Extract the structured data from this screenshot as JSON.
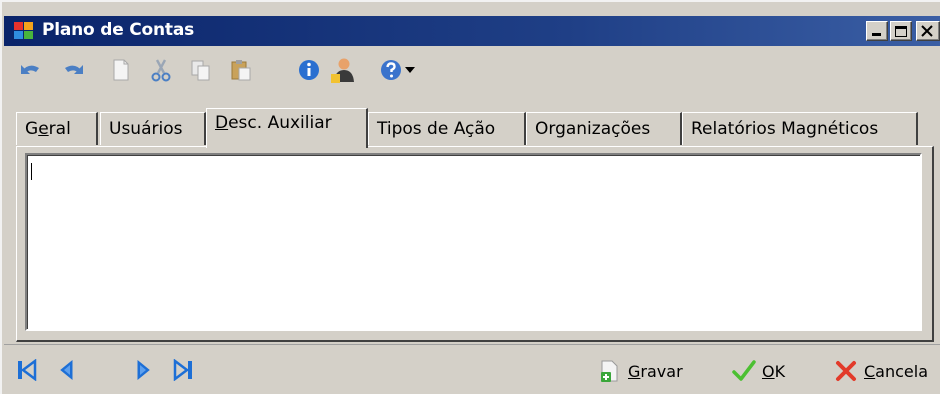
{
  "window": {
    "title": "Plano de Contas",
    "controls": [
      "minimize",
      "maximize",
      "close"
    ]
  },
  "toolbar": {
    "buttons": [
      {
        "name": "undo-icon"
      },
      {
        "name": "redo-icon"
      },
      {
        "name": "new-document-icon"
      },
      {
        "name": "cut-icon"
      },
      {
        "name": "copy-icon"
      },
      {
        "name": "paste-icon"
      },
      {
        "name": "info-icon"
      },
      {
        "name": "user-icon"
      },
      {
        "name": "help-icon"
      },
      {
        "name": "dropdown-arrow-icon"
      }
    ]
  },
  "tabs": [
    {
      "label_pre": "G",
      "label_ul": "e",
      "label_post": "ral",
      "active": false
    },
    {
      "label": "Usuários",
      "active": false
    },
    {
      "label_ul": "D",
      "label_post": "esc. Auxiliar",
      "active": true
    },
    {
      "label": "Tipos de Ação",
      "active": false
    },
    {
      "label": "Organizações",
      "active": false
    },
    {
      "label": "Relatórios Magnéticos",
      "active": false
    }
  ],
  "memo": {
    "value": ""
  },
  "navigation": [
    "first-record-icon",
    "previous-record-icon",
    "next-record-icon",
    "last-record-icon"
  ],
  "actions": {
    "save": {
      "ul": "G",
      "rest": "ravar"
    },
    "ok": {
      "ul": "O",
      "rest": "K"
    },
    "cancel": {
      "ul": "C",
      "rest": "ancela"
    }
  },
  "colors": {
    "titlebar_start": "#0a246a",
    "titlebar_end": "#3b5fa5",
    "face": "#d4d0c8",
    "nav_blue": "#1d6fd6"
  }
}
